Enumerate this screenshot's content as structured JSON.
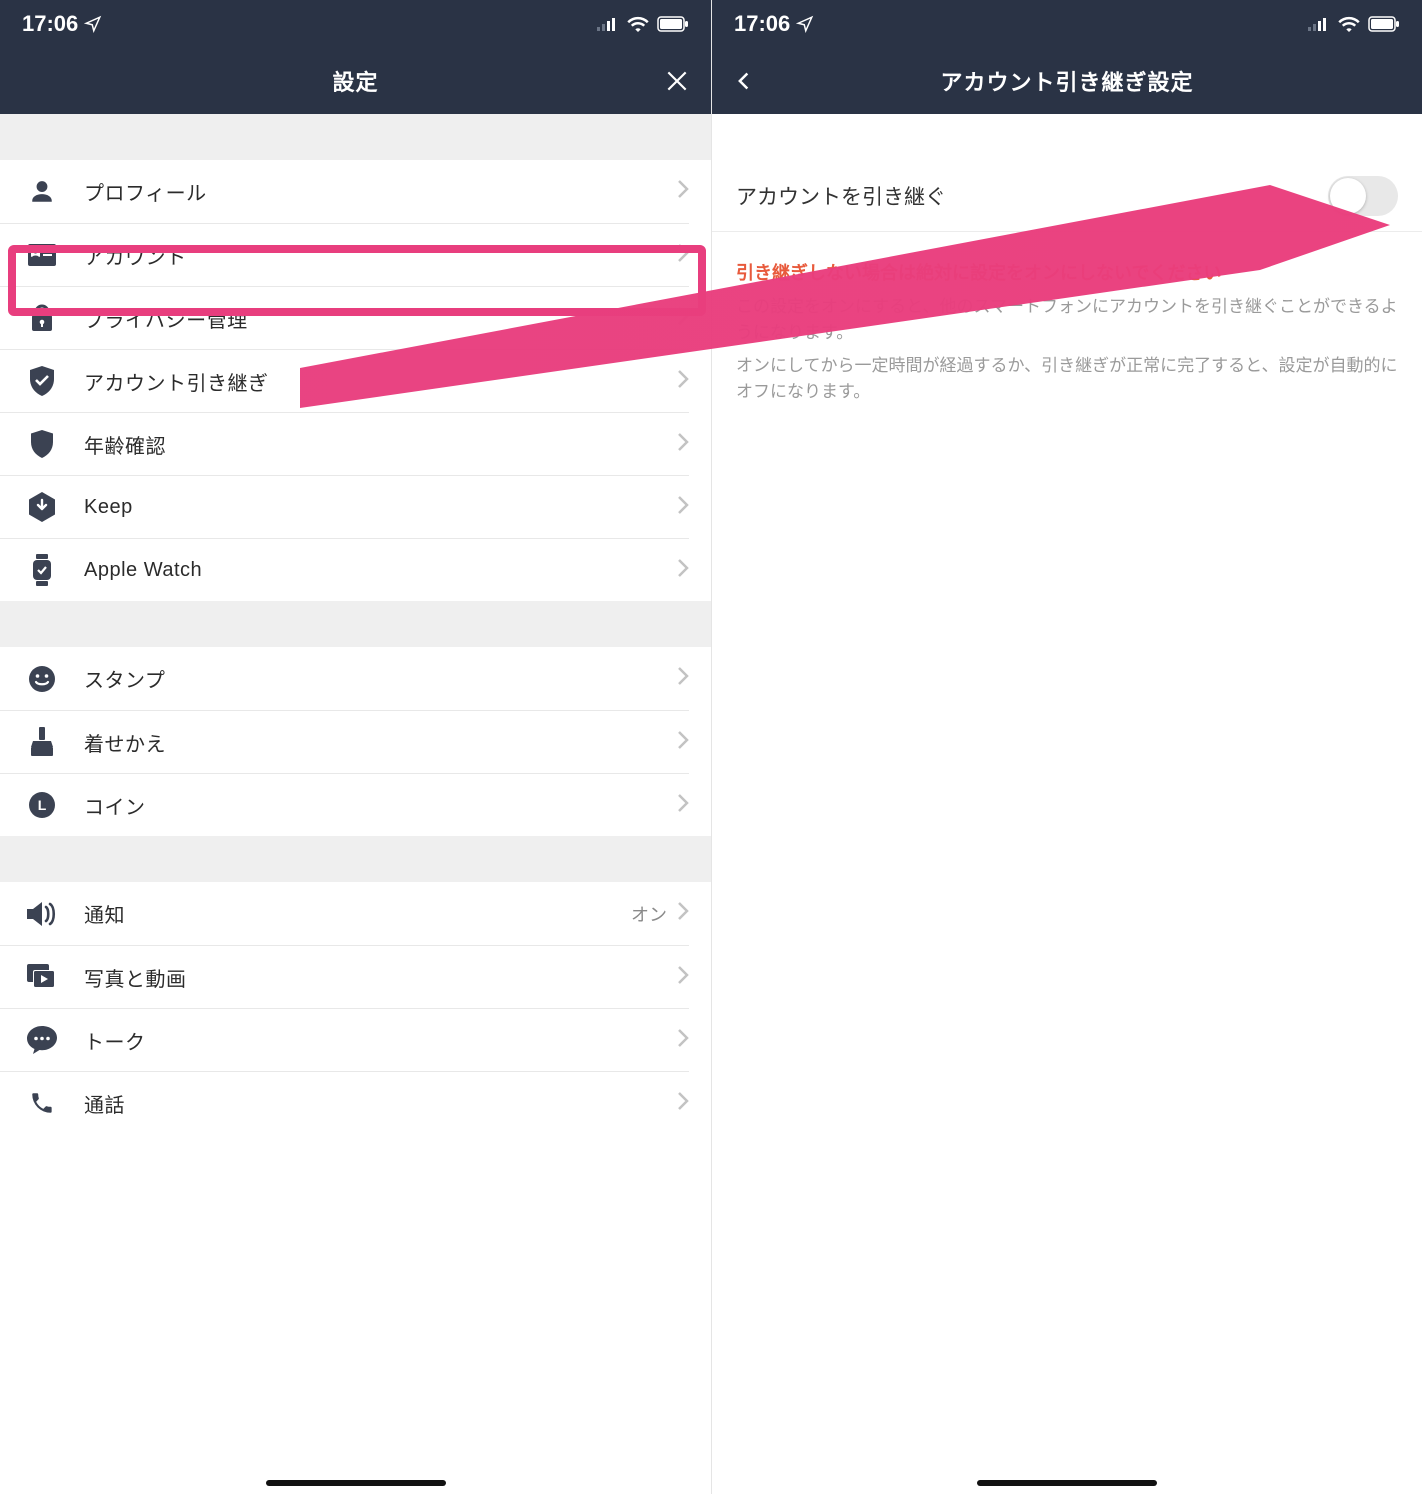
{
  "status": {
    "time": "17:06"
  },
  "left": {
    "title": "設定",
    "groups": [
      {
        "items": [
          {
            "icon": "user-icon",
            "label": "プロフィール"
          },
          {
            "icon": "id-card-icon",
            "label": "アカウント"
          },
          {
            "icon": "lock-icon",
            "label": "プライバシー管理"
          },
          {
            "icon": "shield-check-icon",
            "label": "アカウント引き継ぎ"
          },
          {
            "icon": "shield-icon",
            "label": "年齢確認"
          },
          {
            "icon": "keep-hex-icon",
            "label": "Keep"
          },
          {
            "icon": "watch-icon",
            "label": "Apple Watch"
          }
        ]
      },
      {
        "items": [
          {
            "icon": "smile-icon",
            "label": "スタンプ"
          },
          {
            "icon": "brush-icon",
            "label": "着せかえ"
          },
          {
            "icon": "coin-icon",
            "label": "コイン"
          }
        ]
      },
      {
        "items": [
          {
            "icon": "speaker-icon",
            "label": "通知",
            "value": "オン"
          },
          {
            "icon": "media-icon",
            "label": "写真と動画"
          },
          {
            "icon": "chat-icon",
            "label": "トーク"
          },
          {
            "icon": "phone-icon",
            "label": "通話"
          }
        ]
      }
    ],
    "highlighted_index": [
      0,
      3
    ]
  },
  "right": {
    "title": "アカウント引き継ぎ設定",
    "toggle_label": "アカウントを引き継ぐ",
    "toggle_on": false,
    "warning_red": "引き継ぎしない場合は絶対に設定をオンにしないでください",
    "warning_gray_1": "この設定をオンにすると、他のスマートフォンにアカウントを引き継ぐことができるようになります。",
    "warning_gray_2": "オンにしてから一定時間が経過するか、引き継ぎが正常に完了すると、設定が自動的にオフになります。"
  }
}
